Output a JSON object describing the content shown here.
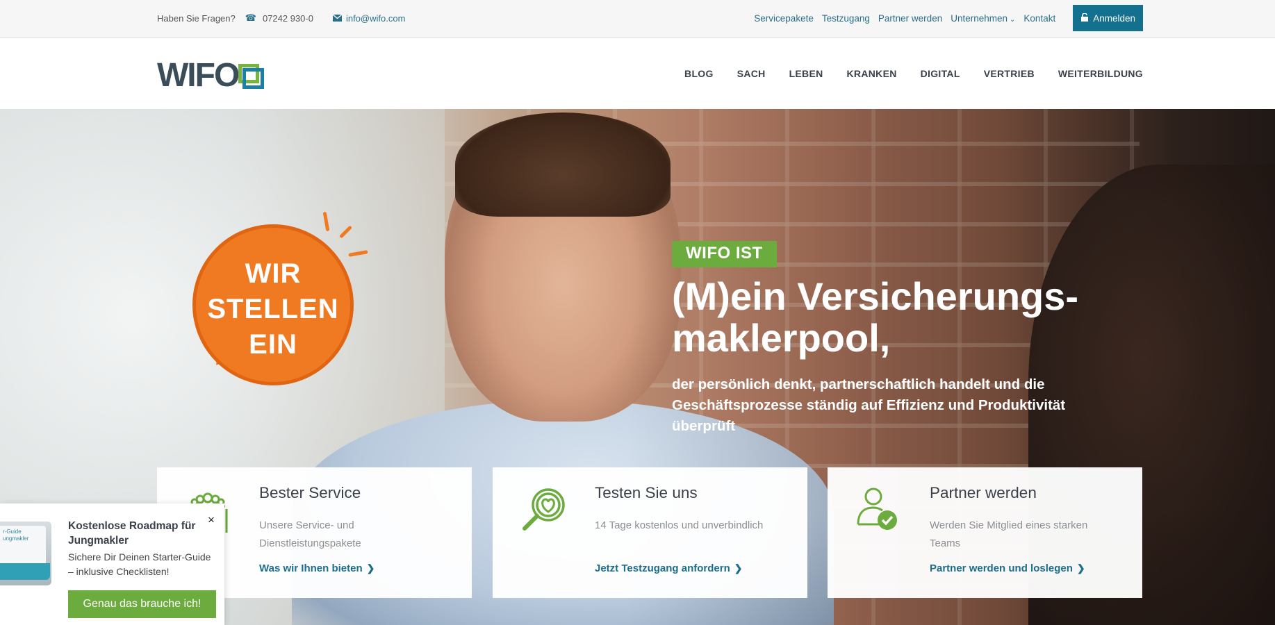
{
  "topbar": {
    "question": "Haben Sie Fragen?",
    "phone": "07242 930-0",
    "email": "info@wifo.com",
    "links": [
      "Servicepakete",
      "Testzugang",
      "Partner werden",
      "Unternehmen",
      "Kontakt"
    ],
    "login": "Anmelden"
  },
  "logo": {
    "text": "WIFO"
  },
  "nav": {
    "items": [
      "BLOG",
      "SACH",
      "LEBEN",
      "KRANKEN",
      "DIGITAL",
      "VERTRIEB",
      "WEITERBILDUNG"
    ]
  },
  "hero": {
    "bubble": [
      "WIR",
      "STELLEN",
      "EIN"
    ],
    "tag": "WIFO IST",
    "headline": "(M)ein Versicherungs-maklerpool,",
    "subline": "der persönlich denkt, partnerschaftlich handelt und die Geschäftsprozesse ständig auf Effizienz und Produktivität überprüft"
  },
  "cards": [
    {
      "title": "Bester Service",
      "desc": "Unsere Service- und Dienstleistungspakete",
      "link": "Was wir Ihnen bieten",
      "icon": "service-icon"
    },
    {
      "title": "Testen Sie uns",
      "desc": "14 Tage kostenlos und unverbindlich",
      "link": "Jetzt Testzugang anfordern",
      "icon": "magnifier-heart-icon"
    },
    {
      "title": "Partner werden",
      "desc": "Werden Sie Mitglied eines starken Teams",
      "link": "Partner werden und loslegen",
      "icon": "user-check-icon"
    }
  ],
  "popup": {
    "title": "Kostenlose Roadmap für Jungmakler",
    "desc": "Sichere Dir Deinen Starter-Guide – inklusive Checklisten!",
    "cta": "Genau das brauche ich!",
    "close": "×",
    "book_text": "r-Guide ungmakler"
  },
  "colors": {
    "brand_teal": "#13708e",
    "brand_green": "#6cab3d",
    "orange": "#f07a21",
    "link": "#2a6f8a"
  }
}
